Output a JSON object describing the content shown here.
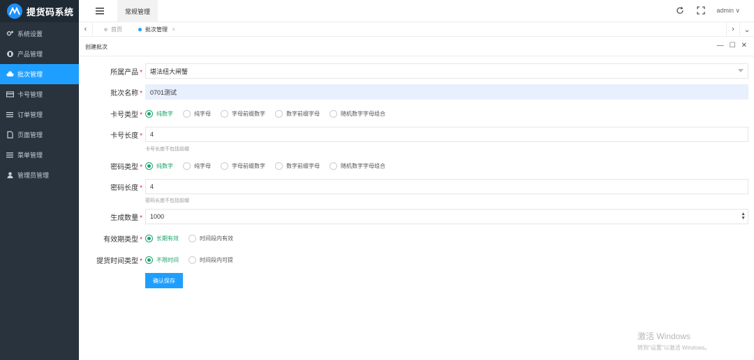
{
  "app": {
    "title": "提货码系统"
  },
  "sidebar": {
    "items": [
      {
        "label": "系统设置",
        "icon": "gears-icon",
        "active": false
      },
      {
        "label": "产品管理",
        "icon": "product-icon",
        "active": false
      },
      {
        "label": "批次管理",
        "icon": "cloud-icon",
        "active": true
      },
      {
        "label": "卡号管理",
        "icon": "card-icon",
        "active": false
      },
      {
        "label": "订单管理",
        "icon": "list-icon",
        "active": false
      },
      {
        "label": "页面管理",
        "icon": "page-icon",
        "active": false
      },
      {
        "label": "菜单管理",
        "icon": "menu-icon",
        "active": false
      },
      {
        "label": "管理员管理",
        "icon": "user-icon",
        "active": false
      }
    ]
  },
  "header": {
    "top_tab": "常规管理",
    "user": "admin ∨"
  },
  "tabs": [
    {
      "label": "首页",
      "active": false
    },
    {
      "label": "批次管理",
      "active": true
    }
  ],
  "panel": {
    "title": "创建批次"
  },
  "form": {
    "product": {
      "label": "所属产品",
      "value": "堪法纽大闸蟹"
    },
    "batch_name": {
      "label": "批次名称",
      "value": "0701测试"
    },
    "card_type": {
      "label": "卡号类型",
      "options": [
        "纯数字",
        "纯字母",
        "字母前缀数字",
        "数字前缀字母",
        "随机数字字母组合"
      ],
      "selected": 0
    },
    "card_length": {
      "label": "卡号长度",
      "value": "4",
      "hint": "卡号长度不包括前缀"
    },
    "pwd_type": {
      "label": "密码类型",
      "options": [
        "纯数字",
        "纯字母",
        "字母前缀数字",
        "数字前缀字母",
        "随机数字字母组合"
      ],
      "selected": 0
    },
    "pwd_length": {
      "label": "密码长度",
      "value": "4",
      "hint": "密码长度不包括前缀"
    },
    "quantity": {
      "label": "生成数量",
      "value": "1000"
    },
    "validity_type": {
      "label": "有效期类型",
      "options": [
        "长期有效",
        "时间段内有效"
      ],
      "selected": 0
    },
    "pickup_type": {
      "label": "提货时间类型",
      "options": [
        "不限时间",
        "时间段内可提"
      ],
      "selected": 0
    },
    "submit_label": "确认保存"
  },
  "watermark": {
    "line1": "激活 Windows",
    "line2": "转到\"设置\"以激活 Windows。"
  },
  "colors": {
    "accent": "#1e9fff",
    "sidebar": "#28333e",
    "radio": "#1aa36c"
  }
}
